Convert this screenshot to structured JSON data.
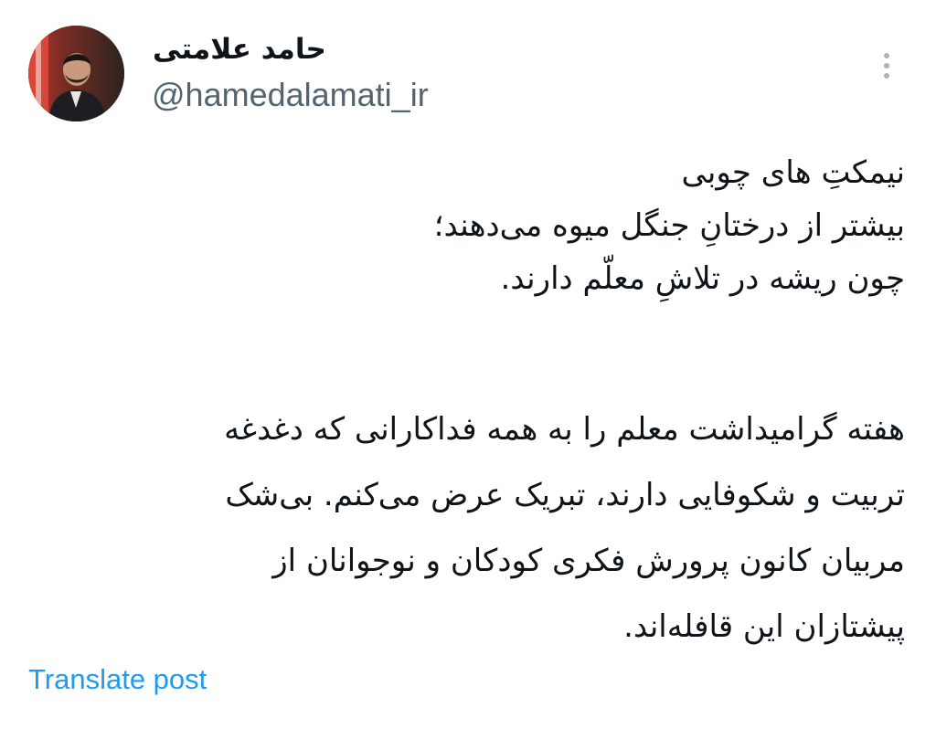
{
  "author": {
    "display_name": "حامد علامتی",
    "handle": "@hamedalamati_ir",
    "avatar_icon": "profile-photo"
  },
  "more_icon": "more-vertical-icon",
  "tweet": {
    "paragraph1": [
      "نیمکتِ های چوبی",
      "بیشتر از درختانِ جنگل میوه می‌دهند؛",
      "چون ریشه در تلاشِ معلّم دارند."
    ],
    "paragraph2": [
      "هفته گرامیداشت معلم را به همه فداکارانی که دغدغه",
      "تربیت و شکوفایی دارند، تبریک عرض می‌کنم. بی‌شک",
      "مربیان کانون پرورش فکری کودکان و نوجوانان از",
      "پیشتازان این قافله‌اند."
    ]
  },
  "translate_label": "Translate post",
  "colors": {
    "text": "#0f1419",
    "secondary": "#536471",
    "link": "#1d9bf0",
    "background": "#ffffff"
  }
}
